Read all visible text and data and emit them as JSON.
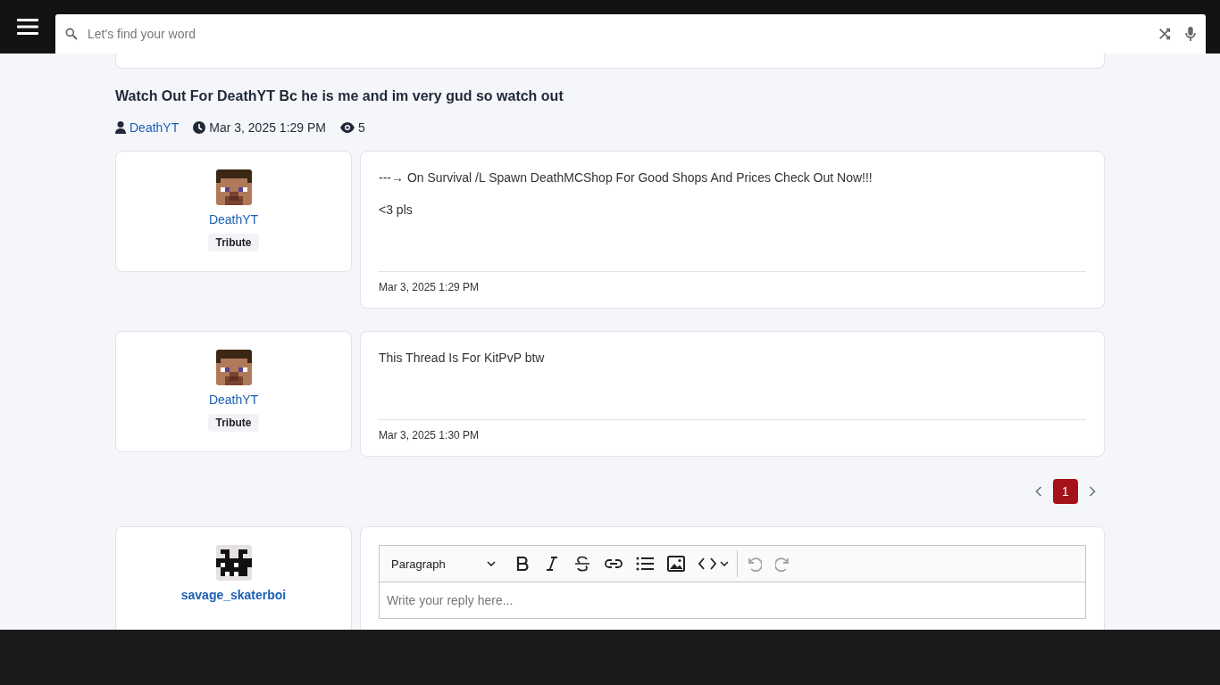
{
  "search": {
    "placeholder": "Let's find your word"
  },
  "thread": {
    "title": "Watch Out For DeathYT Bc he is me and im very gud so watch out",
    "author": "DeathYT",
    "date": "Mar 3, 2025 1:29 PM",
    "views": "5"
  },
  "posts": [
    {
      "author": "DeathYT",
      "avatar": {
        "kind": "steve"
      },
      "rank": "Tribute",
      "paragraphs": [
        "---→ On Survival /L Spawn DeathMCShop For Good Shops And Prices Check Out Now!!!",
        "<3 pls"
      ],
      "timestamp": "Mar 3, 2025 1:29 PM"
    },
    {
      "author": "DeathYT",
      "avatar": {
        "kind": "steve"
      },
      "rank": "Tribute",
      "paragraphs": [
        "This Thread Is For KitPvP btw"
      ],
      "timestamp": "Mar 3, 2025 1:30 PM"
    }
  ],
  "pagination": [
    {
      "label": "1",
      "selected": true
    }
  ],
  "reply": {
    "author": "savage_skaterboi",
    "avatar": {
      "kind": "mask"
    },
    "block_format": "Paragraph",
    "placeholder": "Write your reply here..."
  }
}
